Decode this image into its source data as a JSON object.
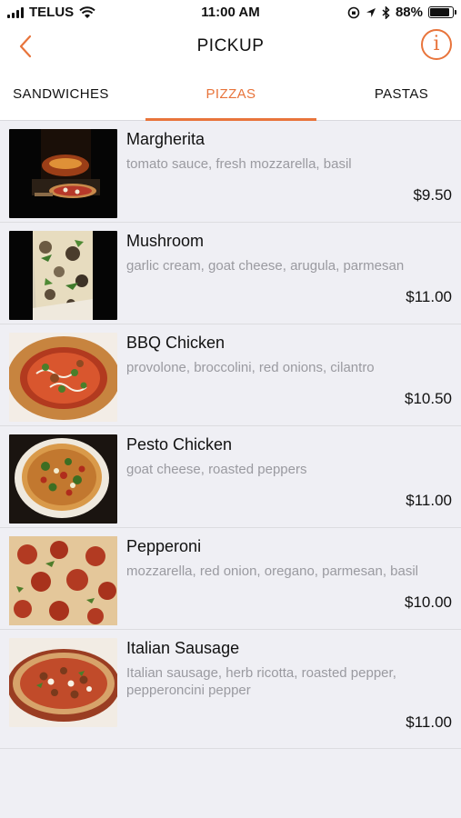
{
  "status": {
    "carrier": "TELUS",
    "time": "11:00 AM",
    "battery": "88%",
    "battery_level": 0.88
  },
  "nav": {
    "title": "PICKUP",
    "back_icon": "chevron-left-icon",
    "info_icon": "info-icon",
    "info_glyph": "i"
  },
  "colors": {
    "accent": "#e8743b",
    "background": "#efeff4"
  },
  "tabs": [
    {
      "label": "SANDWICHES",
      "active": false
    },
    {
      "label": "PIZZAS",
      "active": true
    },
    {
      "label": "PASTAS",
      "active": false
    }
  ],
  "items": [
    {
      "name": "Margherita",
      "description": "tomato sauce, fresh mozzarella, basil",
      "price": "$9.50"
    },
    {
      "name": "Mushroom",
      "description": "garlic cream, goat cheese, arugula, parmesan",
      "price": "$11.00"
    },
    {
      "name": "BBQ Chicken",
      "description": "provolone, broccolini, red onions, cilantro",
      "price": "$10.50"
    },
    {
      "name": "Pesto Chicken",
      "description": "goat cheese, roasted peppers",
      "price": "$11.00"
    },
    {
      "name": "Pepperoni",
      "description": "mozzarella, red onion, oregano, parmesan, basil",
      "price": "$10.00"
    },
    {
      "name": "Italian Sausage",
      "description": "Italian sausage, herb ricotta, roasted pepper, pepperoncini pepper",
      "price": "$11.00"
    }
  ]
}
